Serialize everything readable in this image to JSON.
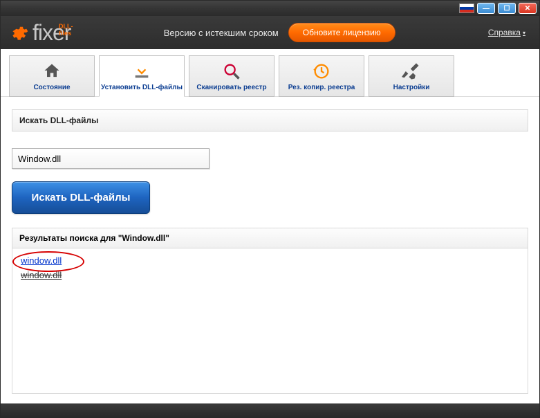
{
  "window": {
    "minimize": "—",
    "maximize": "☐",
    "close": "✕"
  },
  "logo": {
    "sub": "DLL-files",
    "main": "fixer"
  },
  "header": {
    "expired": "Версию с истекшим сроком",
    "update": "Обновите лицензию",
    "help": "Справка"
  },
  "tabs": [
    {
      "label": "Состояние"
    },
    {
      "label": "Установить DLL-файлы"
    },
    {
      "label": "Сканировать реестр"
    },
    {
      "label": "Рез. копир. реестра"
    },
    {
      "label": "Настройки"
    }
  ],
  "search": {
    "section_title": "Искать DLL-файлы",
    "value": "Window.dll",
    "button": "Искать DLL-файлы"
  },
  "results": {
    "header": "Результаты поиска для \"Window.dll\"",
    "items": [
      {
        "text": "window.dll",
        "struck": false
      },
      {
        "text": "window.dll",
        "struck": true
      }
    ]
  }
}
